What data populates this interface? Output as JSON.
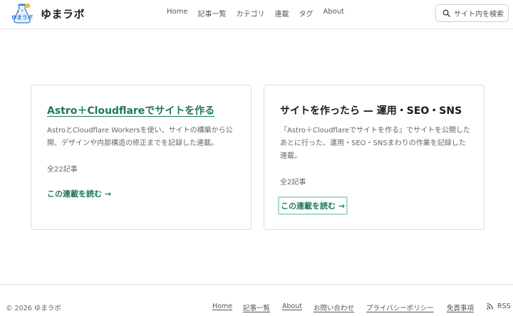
{
  "header": {
    "logo_text": "ゆまラボ",
    "site_name": "ゆまラボ",
    "nav": [
      "Home",
      "記事一覧",
      "カテゴリ",
      "連載",
      "タグ",
      "About"
    ],
    "search_placeholder": "サイト内を検索"
  },
  "series": [
    {
      "title": "Astro＋Cloudflareでサイトを作る",
      "description": "AstroとCloudflare Workersを使い、サイトの構築から公開、デザインや内部構造の修正までを記録した連載。",
      "count": "全22記事",
      "link": "この連載を読む →"
    },
    {
      "title": "サイトを作ったら — 運用・SEO・SNS",
      "description": "『Astro＋Cloudflareでサイトを作る』でサイトを公開したあとに行った、運用・SEO・SNSまわりの作業を記録した連載。",
      "count": "全2記事",
      "link": "この連載を読む →"
    }
  ],
  "footer": {
    "copyright": "© 2026 ゆまラボ",
    "links": [
      "Home",
      "記事一覧",
      "About",
      "お問い合わせ",
      "プライバシーポリシー",
      "免責事項"
    ],
    "rss": "RSS"
  },
  "colors": {
    "accent": "#1d7a55",
    "focus_ring": "#a8dcc6",
    "logo_blue": "#2f7fd6"
  }
}
